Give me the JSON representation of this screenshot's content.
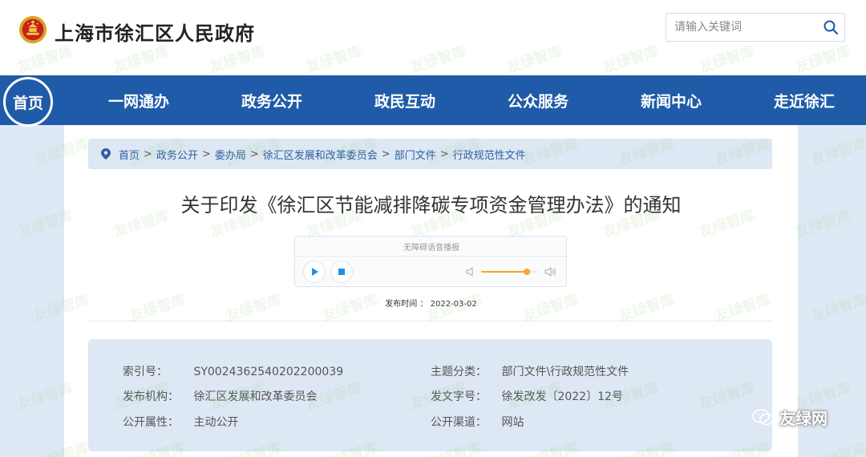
{
  "header": {
    "site_title": "上海市徐汇区人民政府",
    "search_placeholder": "请输入关键词"
  },
  "nav": {
    "home_label": "首页",
    "items": [
      "一网通办",
      "政务公开",
      "政民互动",
      "公众服务",
      "新闻中心",
      "走近徐汇"
    ]
  },
  "breadcrumb": [
    "首页",
    "政务公开",
    "委办局",
    "徐汇区发展和改革委员会",
    "部门文件",
    "行政规范性文件"
  ],
  "article": {
    "title": "关于印发《徐汇区节能减排降碳专项资金管理办法》的通知",
    "player_label": "无障碍语音播报",
    "volume_level": 0.82,
    "publish_label": "发布时间",
    "publish_sep": "：",
    "publish_date": "2022-03-02"
  },
  "meta": {
    "index_label": "索引号：",
    "index_value": "SY0024362540202200039",
    "org_label": "发布机构：",
    "org_value": "徐汇区发展和改革委员会",
    "open_attr_label": "公开属性：",
    "open_attr_value": "主动公开",
    "topic_label": "主题分类：",
    "topic_value": "部门文件\\行政规范性文件",
    "doc_no_label": "发文字号：",
    "doc_no_value": "徐发改发〔2022〕12号",
    "channel_label": "公开渠道：",
    "channel_value": "网站"
  },
  "watermark": {
    "text": "友绿智库",
    "brand": "友绿网"
  },
  "colors": {
    "nav_blue": "#1f5ba8",
    "panel_blue": "#dde8f4",
    "accent_orange": "#f5a623"
  }
}
